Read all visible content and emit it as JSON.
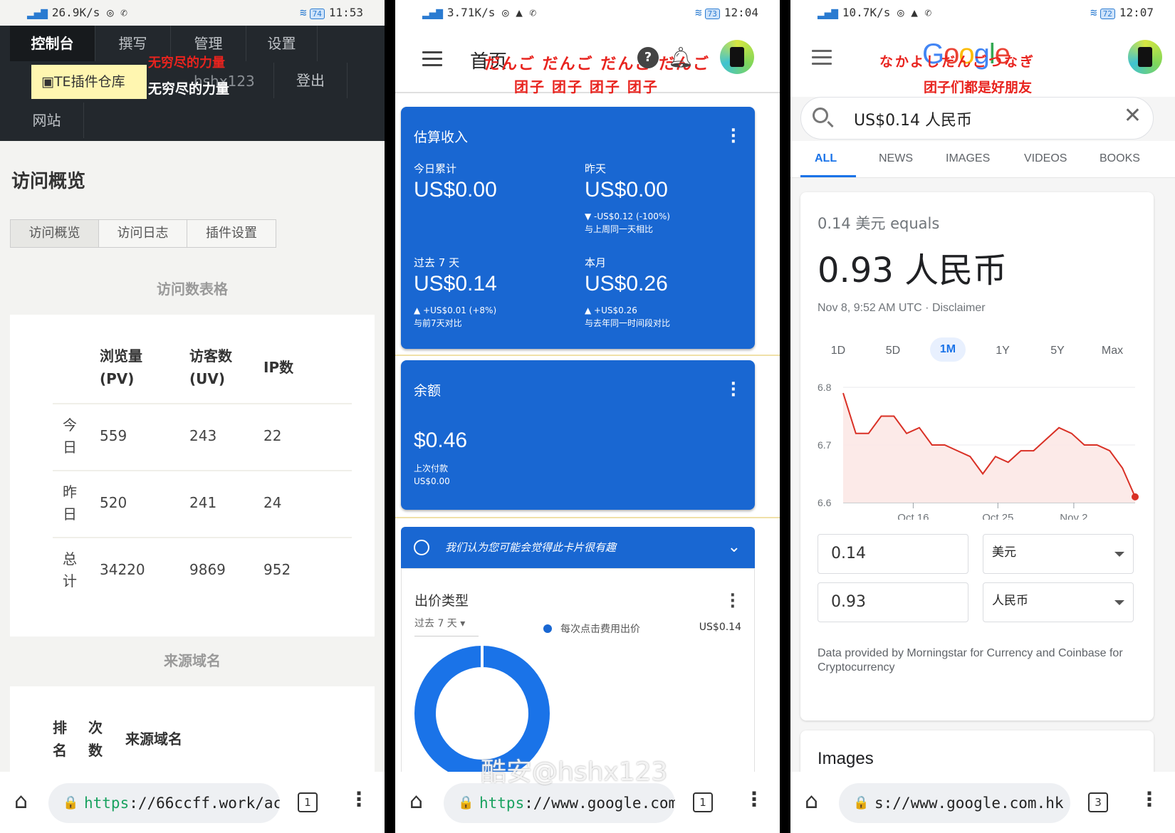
{
  "panel1": {
    "status": {
      "speed": "26.9K/s",
      "battery": "74",
      "time": "11:53"
    },
    "nav": {
      "tabs": [
        "控制台",
        "撰写",
        "管理",
        "设置"
      ],
      "te_button": "TE插件仓库",
      "overlay_red": "无穷尽的力量",
      "overlay_white": "无穷尽的力量",
      "user": "hshx123",
      "logout": "登出",
      "site": "网站"
    },
    "title": "访问概览",
    "subtabs": [
      "访问概览",
      "访问日志",
      "插件设置"
    ],
    "table_title": "访问数表格",
    "table": {
      "headers": [
        "浏览量 (PV)",
        "访客数 (UV)",
        "IP数"
      ],
      "rows": [
        {
          "label": "今日",
          "pv": "559",
          "uv": "243",
          "ip": "22"
        },
        {
          "label": "昨日",
          "pv": "520",
          "uv": "241",
          "ip": "24"
        },
        {
          "label": "总计",
          "pv": "34220",
          "uv": "9869",
          "ip": "952"
        }
      ]
    },
    "source_title": "来源域名",
    "source_headers": [
      "排名",
      "次数",
      "来源域名"
    ],
    "url_scheme": "https",
    "url_rest": "://66ccff.work/ac",
    "tab_count": "1"
  },
  "panel2": {
    "status": {
      "speed": "3.71K/s",
      "battery": "73",
      "time": "12:04"
    },
    "header_title": "首页",
    "overlay_red1": "だんご だんご だんご だんご",
    "overlay_red2": "团子 团子 团子 团子",
    "help": "?",
    "earnings": {
      "title": "估算收入",
      "today_label": "今日累计",
      "today_value": "US$0.00",
      "yesterday_label": "昨天",
      "yesterday_value": "US$0.00",
      "yesterday_delta": "▼ -US$0.12 (-100%)",
      "yesterday_cmp": "与上周同一天相比",
      "week_label": "过去 7 天",
      "week_value": "US$0.14",
      "week_delta": "▲ +US$0.01 (+8%)",
      "week_cmp": "与前7天对比",
      "month_label": "本月",
      "month_value": "US$0.26",
      "month_delta": "▲ +US$0.26",
      "month_cmp": "与去年同一时间段对比"
    },
    "balance": {
      "title": "余额",
      "value": "$0.46",
      "last_payment_label": "上次付款",
      "last_payment_value": "US$0.00"
    },
    "insight": "我们认为您可能会觉得此卡片很有趣",
    "bid": {
      "title": "出价类型",
      "range": "过去 7 天",
      "legend": "每次点击费用出价",
      "legend_value": "US$0.14"
    },
    "url_scheme": "https",
    "url_rest": "://www.google.com",
    "tab_count": "1"
  },
  "panel3": {
    "status": {
      "speed": "10.7K/s",
      "battery": "72",
      "time": "12:07"
    },
    "overlay_red1": "なかよしだんごつなぎ",
    "overlay_red2": "团子们都是好朋友",
    "search_query": "US$0.14 人民币",
    "tabs": [
      "ALL",
      "NEWS",
      "IMAGES",
      "VIDEOS",
      "BOOKS"
    ],
    "equals": "0.14 美元 equals",
    "result": "0.93 人民币",
    "meta": "Nov 8, 9:52 AM UTC · Disclaimer",
    "ranges": [
      "1D",
      "5D",
      "1M",
      "1Y",
      "5Y",
      "Max"
    ],
    "from_value": "0.14",
    "from_currency": "美元",
    "to_value": "0.93",
    "to_currency": "人民币",
    "source": "Data provided by Morningstar for Currency and Coinbase for Cryptocurrency",
    "images_title": "Images",
    "url_rest": "s://www.google.com.hk",
    "tab_count": "3"
  },
  "chart_data": {
    "type": "area",
    "yticks": [
      "6.8",
      "6.7",
      "6.6"
    ],
    "xticks": [
      "Oct 16",
      "Oct 25",
      "Nov 2"
    ],
    "ylim": [
      6.6,
      6.8
    ],
    "x": [
      0,
      1,
      2,
      3,
      4,
      5,
      6,
      7,
      8,
      9,
      10,
      11,
      12,
      13,
      14,
      15,
      16,
      17,
      18,
      19,
      20,
      21,
      22,
      23
    ],
    "values": [
      6.79,
      6.72,
      6.72,
      6.75,
      6.75,
      6.72,
      6.73,
      6.7,
      6.7,
      6.69,
      6.68,
      6.65,
      6.68,
      6.67,
      6.69,
      6.69,
      6.71,
      6.73,
      6.72,
      6.7,
      6.7,
      6.69,
      6.66,
      6.61
    ],
    "line_color": "#d93025",
    "fill_color": "#fce8e6"
  },
  "watermark": "酷安@hshx123"
}
